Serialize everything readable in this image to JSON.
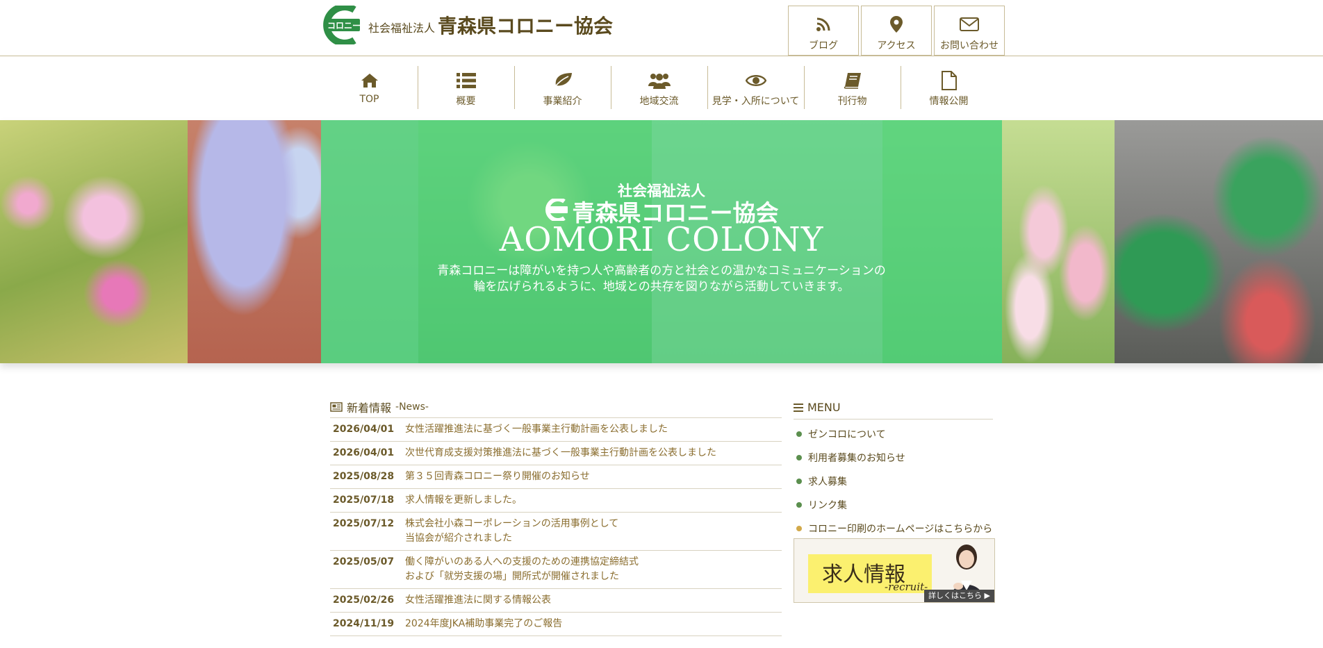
{
  "header": {
    "logo_mark_text": "コロニー",
    "corp_type": "社会福祉法人",
    "org_name": "青森県コロニー協会",
    "top_buttons": [
      {
        "label": "ブログ",
        "icon": "rss-icon"
      },
      {
        "label": "アクセス",
        "icon": "map-pin-icon"
      },
      {
        "label": "お問い合わせ",
        "icon": "envelope-icon"
      }
    ]
  },
  "nav": {
    "items": [
      {
        "label": "TOP",
        "icon": "home-icon"
      },
      {
        "label": "概要",
        "icon": "list-icon"
      },
      {
        "label": "事業紹介",
        "icon": "leaf-icon"
      },
      {
        "label": "地域交流",
        "icon": "users-icon"
      },
      {
        "label": "見学・入所について",
        "icon": "eye-icon"
      },
      {
        "label": "刊行物",
        "icon": "book-icon"
      },
      {
        "label": "情報公開",
        "icon": "document-icon"
      }
    ]
  },
  "hero": {
    "corp_type": "社会福祉法人",
    "org_name": "青森県コロニー協会",
    "english_name": "AOMORI COLONY",
    "desc_line1": "青森コロニーは障がいを持つ人や高齢者の方と社会との温かなコミュニケーションの",
    "desc_line2": "輪を広げられるように、地域との共存を図りながら活動していきます。"
  },
  "news": {
    "title": "新着情報",
    "subtitle": "-News-",
    "items": [
      {
        "date": "2026/04/01",
        "title_lines": [
          "女性活躍推進法に基づく一般事業主行動計画を公表しました"
        ]
      },
      {
        "date": "2026/04/01",
        "title_lines": [
          "次世代育成支援対策推進法に基づく一般事業主行動計画を公表しました"
        ]
      },
      {
        "date": "2025/08/28",
        "title_lines": [
          "第３５回青森コロニー祭り開催のお知らせ"
        ]
      },
      {
        "date": "2025/07/18",
        "title_lines": [
          "求人情報を更新しました。"
        ]
      },
      {
        "date": "2025/07/12",
        "title_lines": [
          "株式会社小森コーポレーションの活用事例として",
          "当協会が紹介されました"
        ]
      },
      {
        "date": "2025/05/07",
        "title_lines": [
          "働く障がいのある人への支援のための連携協定締結式",
          "および「就労支援の場」開所式が開催されました"
        ]
      },
      {
        "date": "2025/02/26",
        "title_lines": [
          "女性活躍推進法に関する情報公表"
        ]
      },
      {
        "date": "2024/11/19",
        "title_lines": [
          "2024年度JKA補助事業完了のご報告"
        ]
      }
    ]
  },
  "menu": {
    "title": "MENU",
    "items": [
      {
        "label": "ゼンコロについて",
        "dot": "#5b8f4e"
      },
      {
        "label": "利用者募集のお知らせ",
        "dot": "#5b8f4e"
      },
      {
        "label": "求人募集",
        "dot": "#5b8f4e"
      },
      {
        "label": "リンク集",
        "dot": "#5b8f4e"
      },
      {
        "label": "コロニー印刷のホームページはこちらから",
        "dot": "#d2a94a"
      }
    ]
  },
  "recruit_banner": {
    "title": "求人情報",
    "subtitle": "-recruit-",
    "more": "詳しくはこちら ▶"
  },
  "colors": {
    "brand_green": "#2f8f46",
    "text_brown": "#6b5a2a",
    "hero_overlay": "#50d47d"
  }
}
